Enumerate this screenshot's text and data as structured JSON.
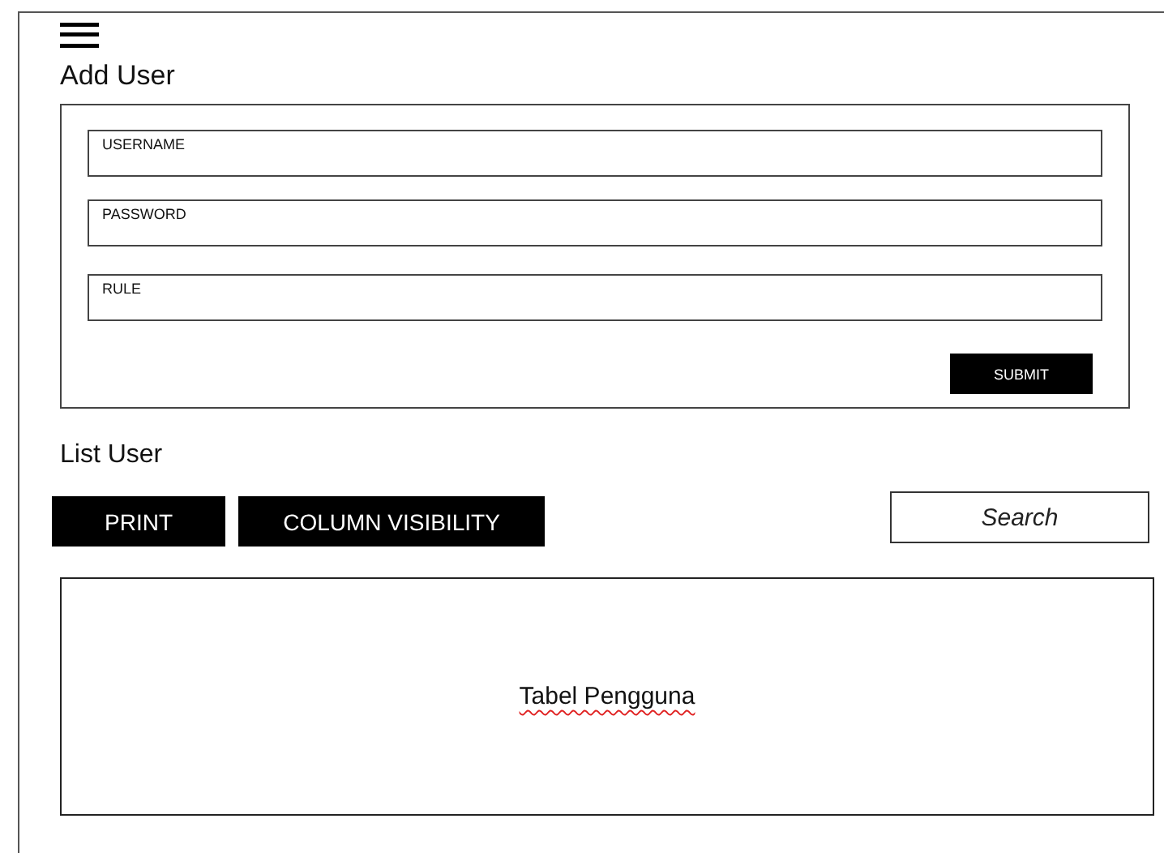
{
  "add_user": {
    "title": "Add User",
    "fields": [
      {
        "placeholder": "USERNAME"
      },
      {
        "placeholder": "PASSWORD"
      },
      {
        "placeholder": "RULE"
      }
    ],
    "submit": "SUBMIT"
  },
  "list_user": {
    "title": "List User",
    "buttons": [
      "PRINT",
      "COLUMN VISIBILITY"
    ],
    "search": {
      "placeholder": "Search"
    },
    "table": {
      "label": "Tabel Pengguna"
    }
  }
}
